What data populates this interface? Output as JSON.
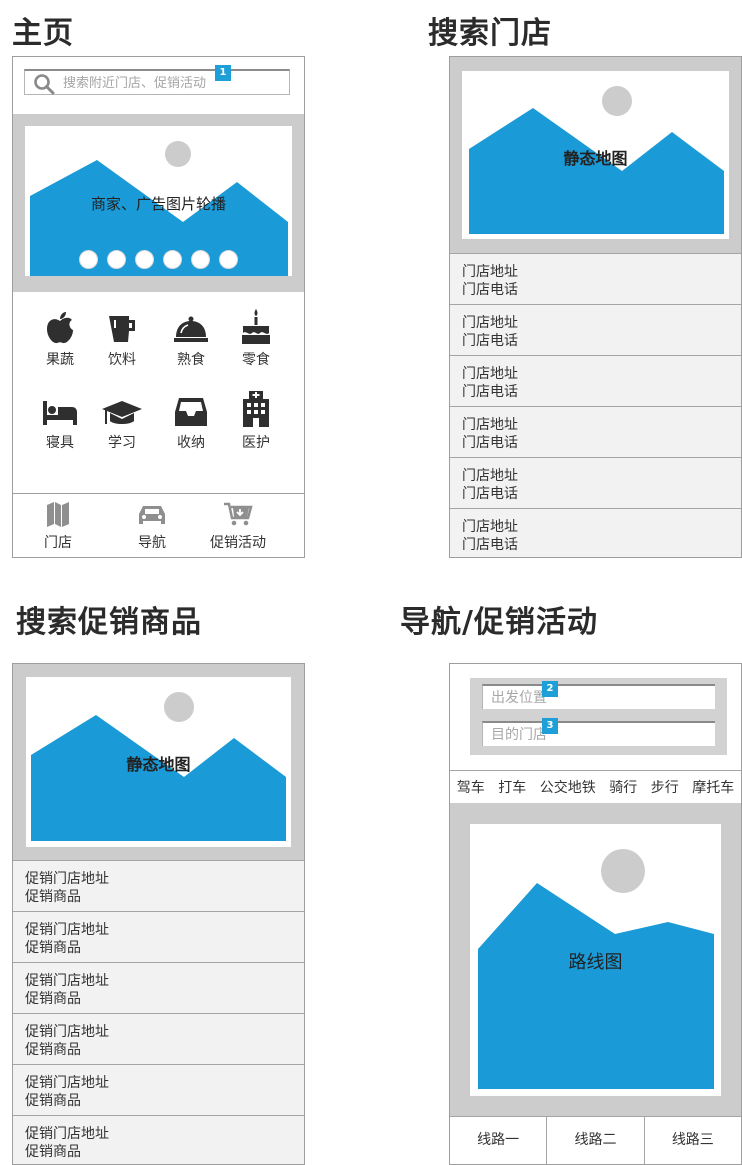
{
  "titles": {
    "home": "主页",
    "search_store": "搜索门店",
    "search_promo": "搜索促销商品",
    "nav_promo": "导航/促销活动"
  },
  "home": {
    "search_placeholder": "搜索附近门店、促销活动",
    "marker": "1",
    "banner_label": "商家、广告图片轮播",
    "carousel_dot_count": 6,
    "categories": [
      {
        "label": "果蔬",
        "icon": "apple-icon"
      },
      {
        "label": "饮料",
        "icon": "cup-icon"
      },
      {
        "label": "熟食",
        "icon": "cloche-icon"
      },
      {
        "label": "零食",
        "icon": "cake-icon"
      },
      {
        "label": "寝具",
        "icon": "bed-icon"
      },
      {
        "label": "学习",
        "icon": "graduation-cap-icon"
      },
      {
        "label": "收纳",
        "icon": "inbox-icon"
      },
      {
        "label": "医护",
        "icon": "hospital-icon"
      }
    ],
    "tabs": [
      {
        "label": "门店",
        "icon": "map-icon"
      },
      {
        "label": "导航",
        "icon": "car-icon"
      },
      {
        "label": "促销活动",
        "icon": "cart-icon"
      }
    ]
  },
  "search_store": {
    "map_label": "静态地图",
    "rows": [
      {
        "line1": "门店地址",
        "line2": "门店电话"
      },
      {
        "line1": "门店地址",
        "line2": "门店电话"
      },
      {
        "line1": "门店地址",
        "line2": "门店电话"
      },
      {
        "line1": "门店地址",
        "line2": "门店电话"
      },
      {
        "line1": "门店地址",
        "line2": "门店电话"
      },
      {
        "line1": "门店地址",
        "line2": "门店电话"
      }
    ]
  },
  "search_promo": {
    "map_label": "静态地图",
    "rows": [
      {
        "line1": "促销门店地址",
        "line2": "促销商品"
      },
      {
        "line1": "促销门店地址",
        "line2": "促销商品"
      },
      {
        "line1": "促销门店地址",
        "line2": "促销商品"
      },
      {
        "line1": "促销门店地址",
        "line2": "促销商品"
      },
      {
        "line1": "促销门店地址",
        "line2": "促销商品"
      },
      {
        "line1": "促销门店地址",
        "line2": "促销商品"
      }
    ]
  },
  "nav": {
    "from_placeholder": "出发位置",
    "from_marker": "2",
    "to_placeholder": "目的门店",
    "to_marker": "3",
    "modes": [
      "驾车",
      "打车",
      "公交地铁",
      "骑行",
      "步行",
      "摩托车"
    ],
    "map_label": "路线图",
    "routes": [
      "线路一",
      "线路二",
      "线路三"
    ]
  },
  "colors": {
    "accent": "#1a9ad6",
    "placeholder_gray": "#cccccc",
    "marker_blue": "#1e9fd8"
  }
}
